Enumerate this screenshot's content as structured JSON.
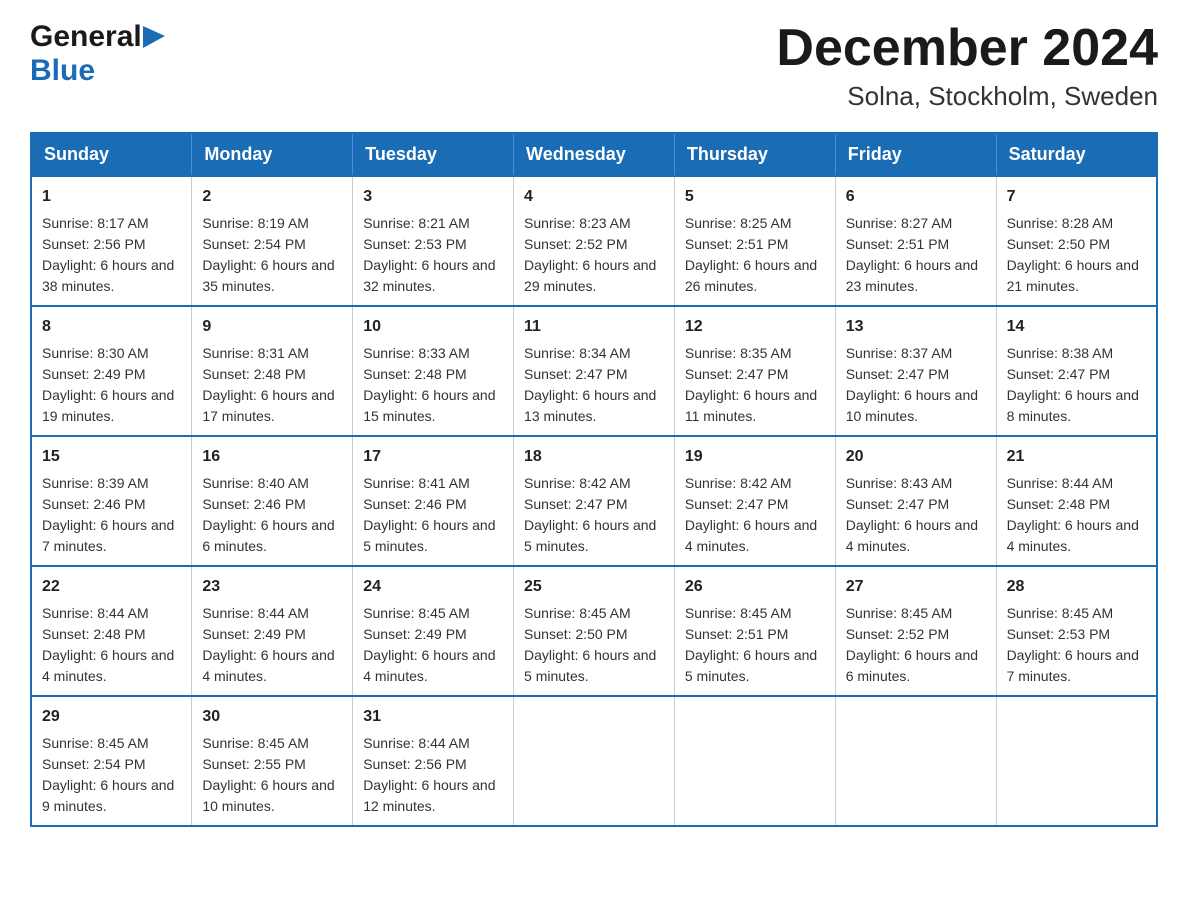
{
  "header": {
    "title": "December 2024",
    "subtitle": "Solna, Stockholm, Sweden",
    "logo_general": "General",
    "logo_blue": "Blue"
  },
  "calendar": {
    "days_of_week": [
      "Sunday",
      "Monday",
      "Tuesday",
      "Wednesday",
      "Thursday",
      "Friday",
      "Saturday"
    ],
    "weeks": [
      [
        {
          "day": "1",
          "sunrise": "8:17 AM",
          "sunset": "2:56 PM",
          "daylight": "6 hours and 38 minutes."
        },
        {
          "day": "2",
          "sunrise": "8:19 AM",
          "sunset": "2:54 PM",
          "daylight": "6 hours and 35 minutes."
        },
        {
          "day": "3",
          "sunrise": "8:21 AM",
          "sunset": "2:53 PM",
          "daylight": "6 hours and 32 minutes."
        },
        {
          "day": "4",
          "sunrise": "8:23 AM",
          "sunset": "2:52 PM",
          "daylight": "6 hours and 29 minutes."
        },
        {
          "day": "5",
          "sunrise": "8:25 AM",
          "sunset": "2:51 PM",
          "daylight": "6 hours and 26 minutes."
        },
        {
          "day": "6",
          "sunrise": "8:27 AM",
          "sunset": "2:51 PM",
          "daylight": "6 hours and 23 minutes."
        },
        {
          "day": "7",
          "sunrise": "8:28 AM",
          "sunset": "2:50 PM",
          "daylight": "6 hours and 21 minutes."
        }
      ],
      [
        {
          "day": "8",
          "sunrise": "8:30 AM",
          "sunset": "2:49 PM",
          "daylight": "6 hours and 19 minutes."
        },
        {
          "day": "9",
          "sunrise": "8:31 AM",
          "sunset": "2:48 PM",
          "daylight": "6 hours and 17 minutes."
        },
        {
          "day": "10",
          "sunrise": "8:33 AM",
          "sunset": "2:48 PM",
          "daylight": "6 hours and 15 minutes."
        },
        {
          "day": "11",
          "sunrise": "8:34 AM",
          "sunset": "2:47 PM",
          "daylight": "6 hours and 13 minutes."
        },
        {
          "day": "12",
          "sunrise": "8:35 AM",
          "sunset": "2:47 PM",
          "daylight": "6 hours and 11 minutes."
        },
        {
          "day": "13",
          "sunrise": "8:37 AM",
          "sunset": "2:47 PM",
          "daylight": "6 hours and 10 minutes."
        },
        {
          "day": "14",
          "sunrise": "8:38 AM",
          "sunset": "2:47 PM",
          "daylight": "6 hours and 8 minutes."
        }
      ],
      [
        {
          "day": "15",
          "sunrise": "8:39 AM",
          "sunset": "2:46 PM",
          "daylight": "6 hours and 7 minutes."
        },
        {
          "day": "16",
          "sunrise": "8:40 AM",
          "sunset": "2:46 PM",
          "daylight": "6 hours and 6 minutes."
        },
        {
          "day": "17",
          "sunrise": "8:41 AM",
          "sunset": "2:46 PM",
          "daylight": "6 hours and 5 minutes."
        },
        {
          "day": "18",
          "sunrise": "8:42 AM",
          "sunset": "2:47 PM",
          "daylight": "6 hours and 5 minutes."
        },
        {
          "day": "19",
          "sunrise": "8:42 AM",
          "sunset": "2:47 PM",
          "daylight": "6 hours and 4 minutes."
        },
        {
          "day": "20",
          "sunrise": "8:43 AM",
          "sunset": "2:47 PM",
          "daylight": "6 hours and 4 minutes."
        },
        {
          "day": "21",
          "sunrise": "8:44 AM",
          "sunset": "2:48 PM",
          "daylight": "6 hours and 4 minutes."
        }
      ],
      [
        {
          "day": "22",
          "sunrise": "8:44 AM",
          "sunset": "2:48 PM",
          "daylight": "6 hours and 4 minutes."
        },
        {
          "day": "23",
          "sunrise": "8:44 AM",
          "sunset": "2:49 PM",
          "daylight": "6 hours and 4 minutes."
        },
        {
          "day": "24",
          "sunrise": "8:45 AM",
          "sunset": "2:49 PM",
          "daylight": "6 hours and 4 minutes."
        },
        {
          "day": "25",
          "sunrise": "8:45 AM",
          "sunset": "2:50 PM",
          "daylight": "6 hours and 5 minutes."
        },
        {
          "day": "26",
          "sunrise": "8:45 AM",
          "sunset": "2:51 PM",
          "daylight": "6 hours and 5 minutes."
        },
        {
          "day": "27",
          "sunrise": "8:45 AM",
          "sunset": "2:52 PM",
          "daylight": "6 hours and 6 minutes."
        },
        {
          "day": "28",
          "sunrise": "8:45 AM",
          "sunset": "2:53 PM",
          "daylight": "6 hours and 7 minutes."
        }
      ],
      [
        {
          "day": "29",
          "sunrise": "8:45 AM",
          "sunset": "2:54 PM",
          "daylight": "6 hours and 9 minutes."
        },
        {
          "day": "30",
          "sunrise": "8:45 AM",
          "sunset": "2:55 PM",
          "daylight": "6 hours and 10 minutes."
        },
        {
          "day": "31",
          "sunrise": "8:44 AM",
          "sunset": "2:56 PM",
          "daylight": "6 hours and 12 minutes."
        },
        null,
        null,
        null,
        null
      ]
    ]
  },
  "labels": {
    "sunrise": "Sunrise:",
    "sunset": "Sunset:",
    "daylight": "Daylight:"
  }
}
